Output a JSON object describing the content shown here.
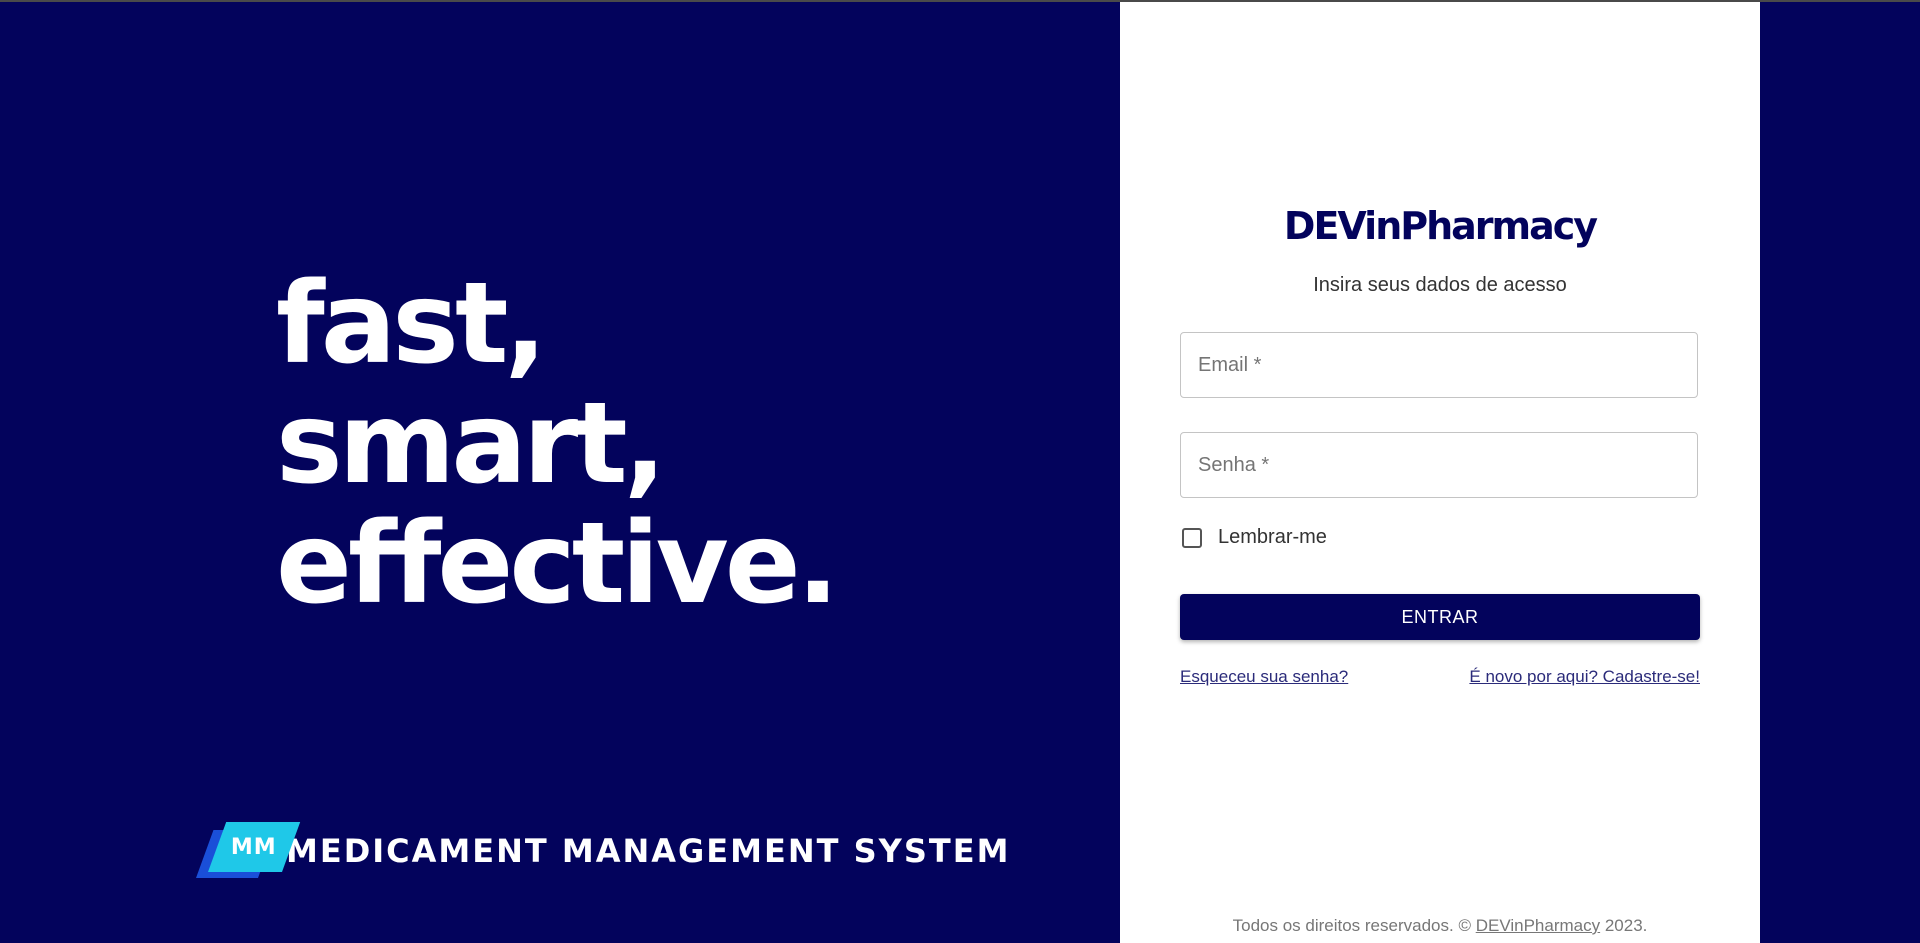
{
  "left": {
    "slogan": [
      "fast,",
      "smart,",
      "effective."
    ],
    "brand": {
      "logo_text": "MM",
      "name": "MEDICAMENT MANAGEMENT SYSTEM"
    }
  },
  "form": {
    "title": "DEVinPharmacy",
    "subtitle": "Insira seus dados de acesso",
    "email_placeholder": "Email *",
    "password_placeholder": "Senha *",
    "remember_label": "Lembrar-me",
    "submit_label": "ENTRAR",
    "forgot_link": "Esqueceu sua senha?",
    "register_link": "É novo por aqui? Cadastre-se!"
  },
  "footer": {
    "prefix": "Todos os direitos reservados. © ",
    "link": "DEVinPharmacy",
    "suffix": " 2023."
  },
  "colors": {
    "brand_navy": "#03035c",
    "logo_cyan": "#1fc8e8",
    "logo_blue": "#1a4fd8"
  }
}
